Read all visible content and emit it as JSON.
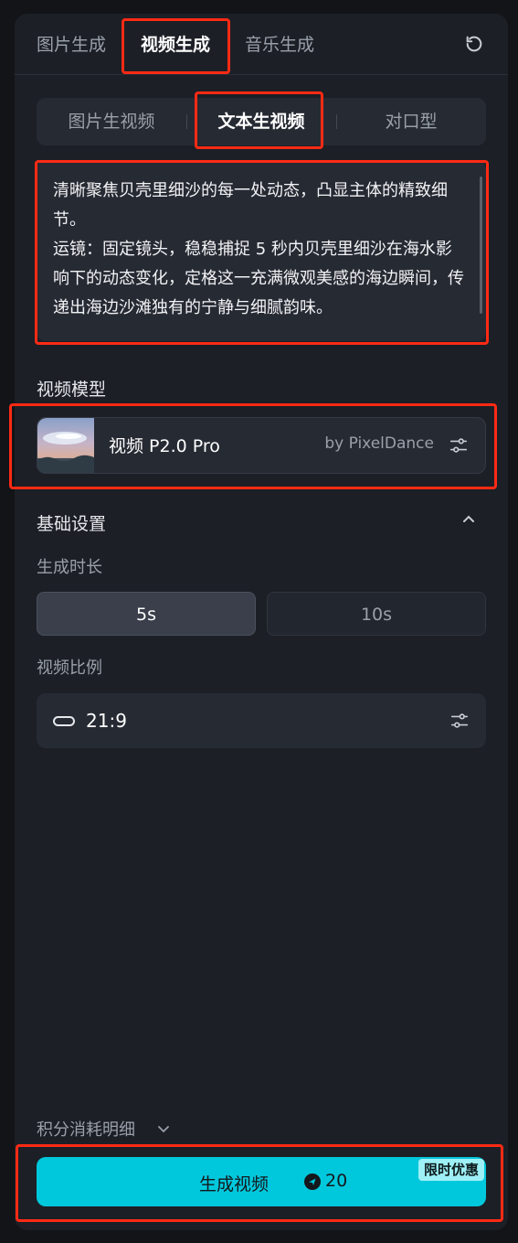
{
  "top_tabs": [
    "图片生成",
    "视频生成",
    "音乐生成"
  ],
  "sub_tabs": [
    "图片生视频",
    "文本生视频",
    "对口型"
  ],
  "prompt": {
    "text": "清晰聚焦贝壳里细沙的每一处动态，凸显主体的精致细节。\n运镜：固定镜头，稳稳捕捉 5 秒内贝壳里细沙在海水影响下的动态变化，定格这一充满微观美感的海边瞬间，传递出海边沙滩独有的宁静与细腻韵味。"
  },
  "model_section": {
    "label": "视频模型",
    "model_name": "视频 P2.0 Pro",
    "model_by": "by PixelDance"
  },
  "basic_settings": {
    "label": "基础设置",
    "duration_label": "生成时长",
    "durations": [
      "5s",
      "10s"
    ],
    "selected_duration": "5s",
    "ratio_label": "视频比例",
    "ratio_value": "21:9"
  },
  "footer": {
    "cost_detail": "积分消耗明细",
    "generate_label": "生成视频",
    "generate_cost": "20",
    "promo_badge": "限时优惠"
  },
  "colors": {
    "accent": "#00c8dc",
    "highlight": "#ff2a14",
    "panel": "#1c1f26"
  }
}
